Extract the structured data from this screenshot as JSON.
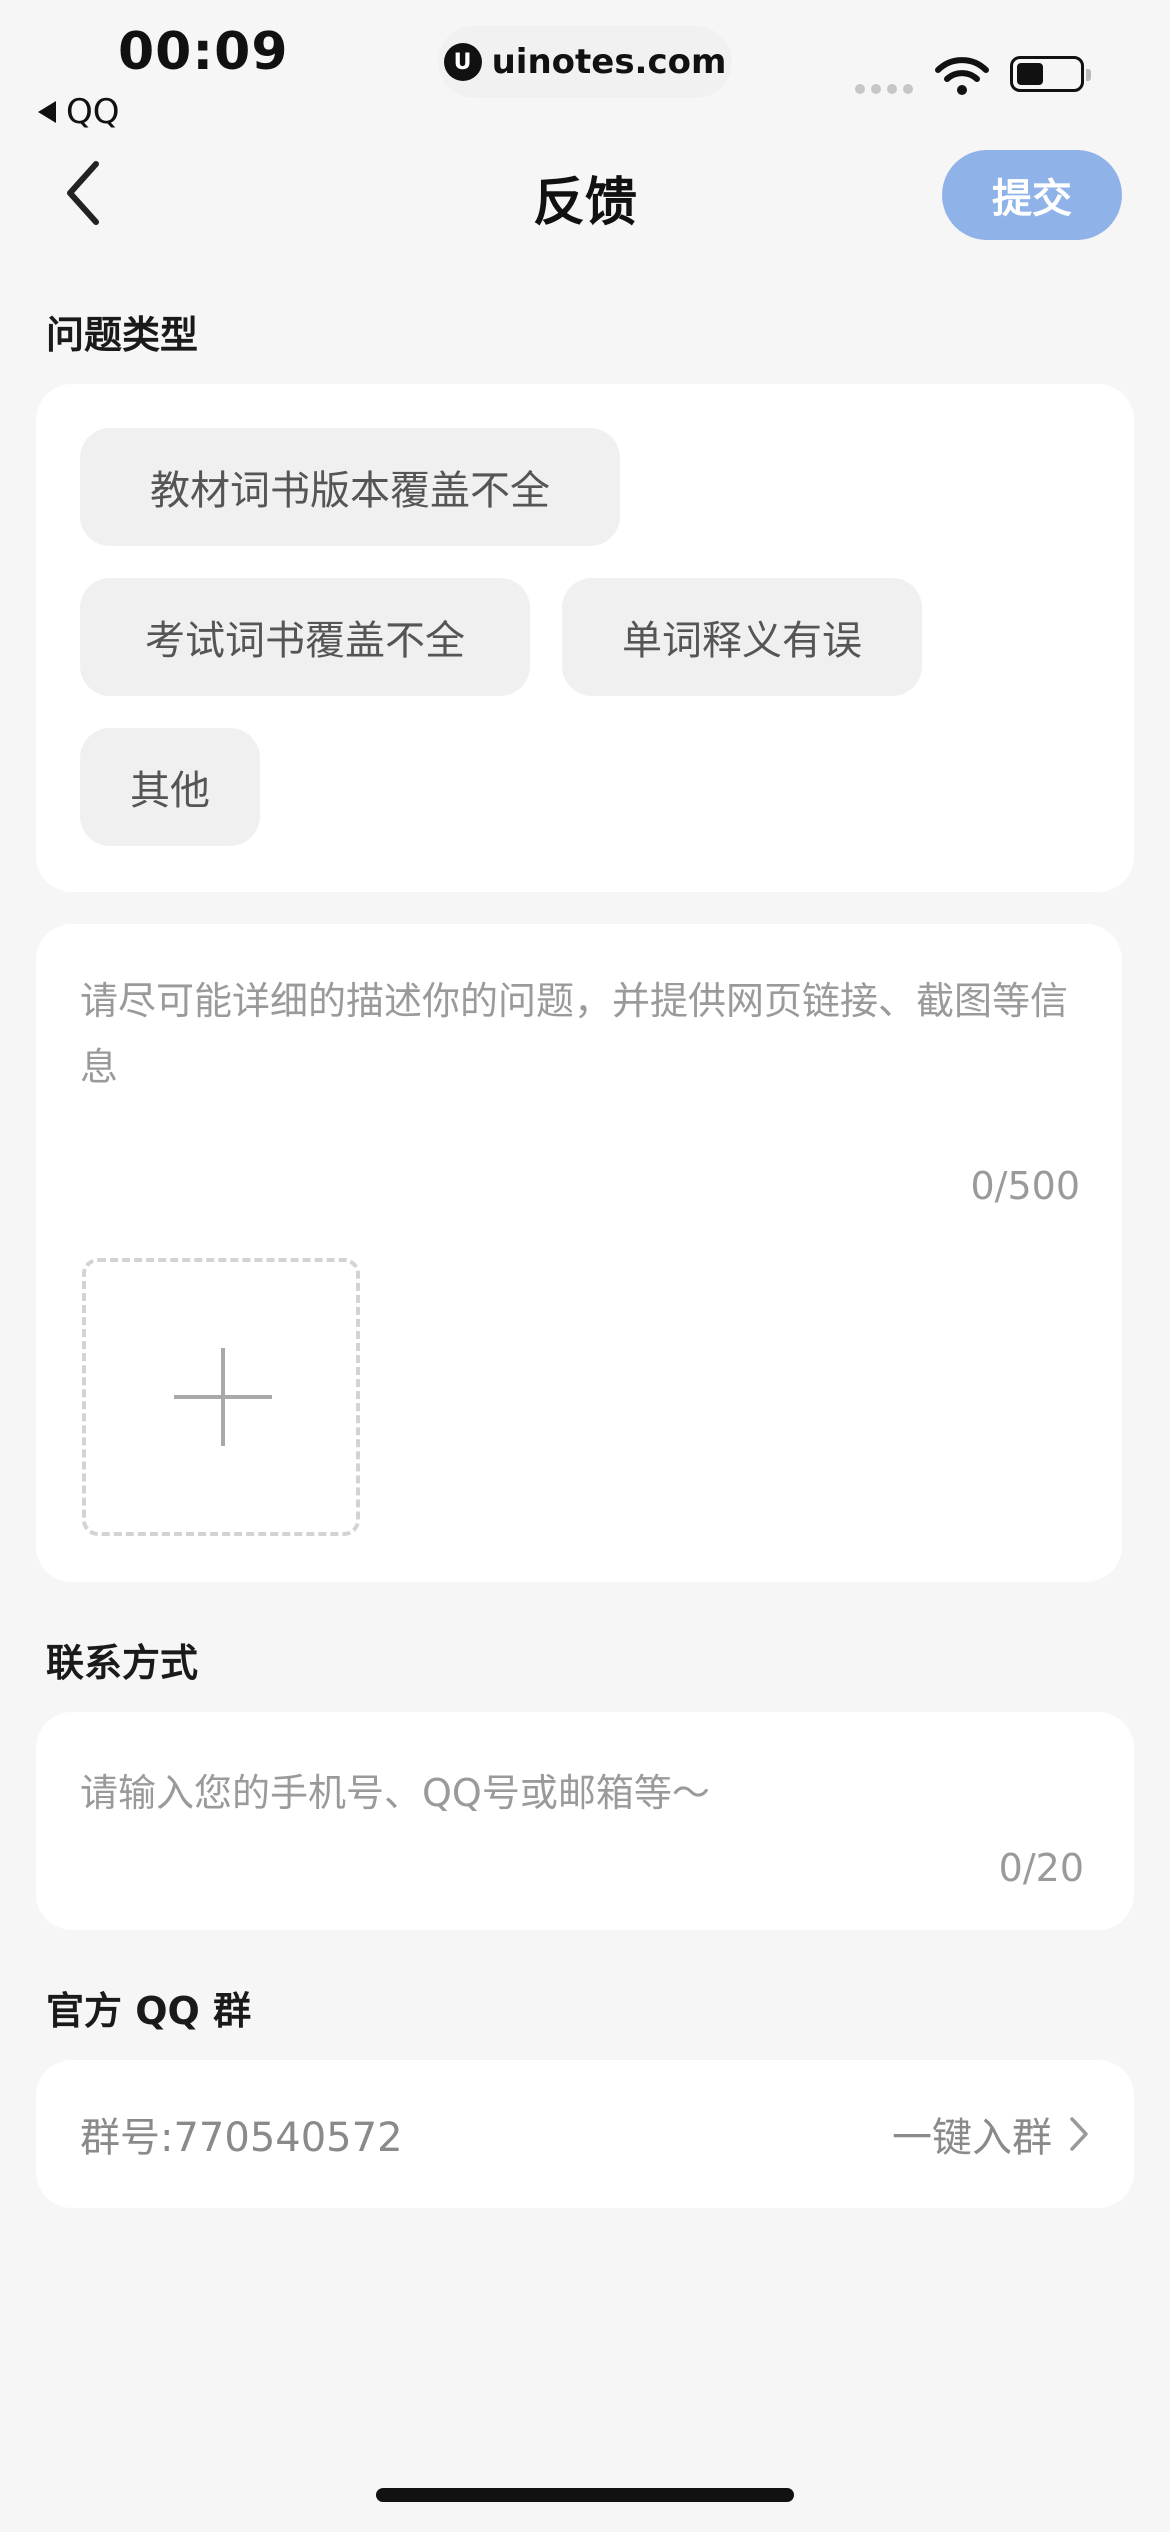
{
  "status_bar": {
    "time": "00:09",
    "back_app": "QQ",
    "url": "uinotes.com",
    "url_logo": "U"
  },
  "nav": {
    "title": "反馈",
    "submit_label": "提交"
  },
  "problem_type": {
    "label": "问题类型",
    "options": [
      "教材词书版本覆盖不全",
      "考试词书覆盖不全",
      "单词释义有误",
      "其他"
    ]
  },
  "description": {
    "placeholder": "请尽可能详细的描述你的问题，并提供网页链接、截图等信息",
    "count": "0/500"
  },
  "contact": {
    "label": "联系方式",
    "placeholder": "请输入您的手机号、QQ号或邮箱等～",
    "count": "0/20"
  },
  "qq_group": {
    "label": "官方 QQ 群",
    "number": "群号:770540572",
    "join_label": "一键入群"
  },
  "colors": {
    "submit_bg": "#8fb3e9",
    "chip_bg": "#f0f0f0",
    "page_bg": "#f6f6f6"
  },
  "icons": {
    "back": "chevron-left-icon",
    "add": "plus-icon",
    "join": "chevron-right-icon",
    "wifi": "wifi-icon",
    "battery": "battery-icon"
  }
}
